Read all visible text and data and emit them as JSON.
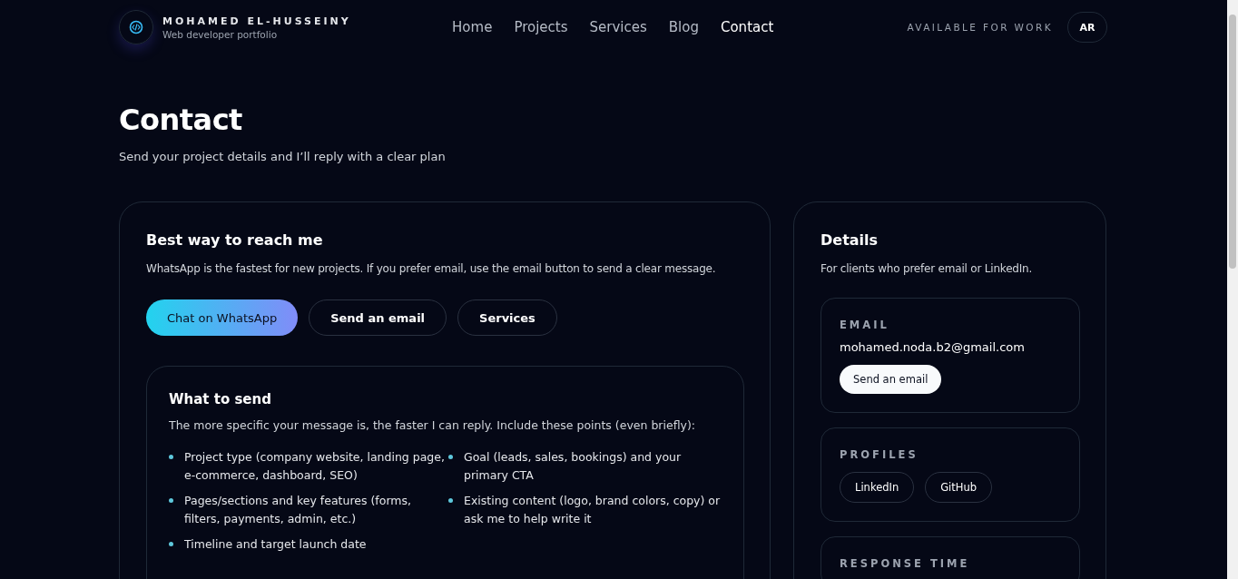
{
  "header": {
    "brand": {
      "name": "MOHAMED EL-HUSSEINY",
      "tagline": "Web developer portfolio"
    },
    "nav": [
      {
        "label": "Home",
        "selected": false
      },
      {
        "label": "Projects",
        "selected": false
      },
      {
        "label": "Services",
        "selected": false
      },
      {
        "label": "Blog",
        "selected": false
      },
      {
        "label": "Contact",
        "selected": true
      }
    ],
    "status": "AVAILABLE FOR WORK",
    "language_button": "AR"
  },
  "page": {
    "title": "Contact",
    "subtitle": "Send your project details and I’ll reply with a clear plan"
  },
  "main_card": {
    "title": "Best way to reach me",
    "text": "WhatsApp is the fastest for new projects. If you prefer email, use the email button to send a clear message.",
    "buttons": [
      {
        "label": "Chat on WhatsApp",
        "kind": "primary"
      },
      {
        "label": "Send an email",
        "kind": "outline"
      },
      {
        "label": "Services",
        "kind": "outline"
      }
    ],
    "what_to_send": {
      "title": "What to send",
      "text": "The more specific your message is, the faster I can reply. Include these points (even briefly):",
      "points": [
        "Project type (company website, landing page, e-commerce, dashboard, SEO)",
        "Goal (leads, sales, bookings) and your primary CTA",
        "Pages/sections and key features (forms, filters, payments, admin, etc.)",
        "Existing content (logo, brand colors, copy) or ask me to help write it",
        "Timeline and target launch date"
      ]
    }
  },
  "details": {
    "title": "Details",
    "text": "For clients who prefer email or LinkedIn.",
    "email": {
      "label": "EMAIL",
      "address": "mohamed.noda.b2@gmail.com",
      "button": "Send an email"
    },
    "profiles": {
      "label": "PROFILES",
      "links": [
        "LinkedIn",
        "GitHub"
      ]
    },
    "response_time": {
      "label": "RESPONSE TIME"
    }
  }
}
